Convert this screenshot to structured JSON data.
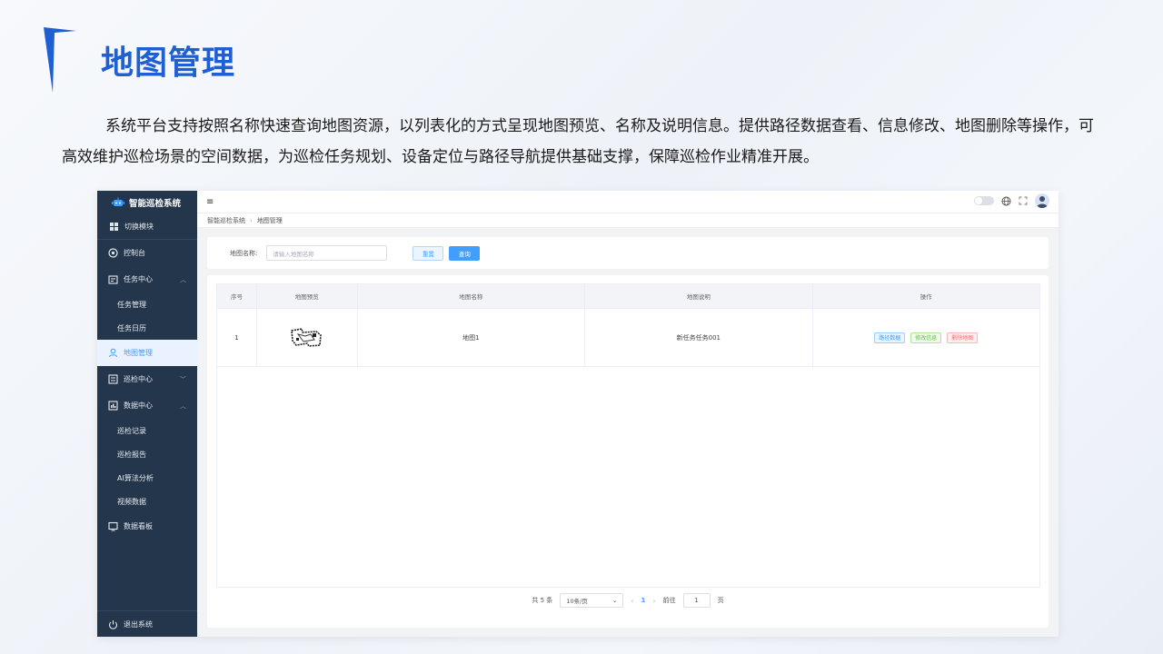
{
  "slide": {
    "title": "地图管理",
    "description": "系统平台支持按照名称快速查询地图资源，以列表化的方式呈现地图预览、名称及说明信息。提供路径数据查看、信息修改、地图删除等操作，可高效维护巡检场景的空间数据，为巡检任务规划、设备定位与路径导航提供基础支撑，保障巡检作业精准开展。",
    "accent_color": "#1e5fd4"
  },
  "app": {
    "brand": "智能巡检系统",
    "sidebar": {
      "switch_module": "切换模块",
      "items": [
        {
          "label": "控制台",
          "icon": "dashboard-icon"
        },
        {
          "label": "任务中心",
          "icon": "task-icon",
          "expanded": true
        },
        {
          "label": "任务管理",
          "sub": true
        },
        {
          "label": "任务日历",
          "sub": true
        },
        {
          "label": "地图管理",
          "icon": "map-icon",
          "active": true
        },
        {
          "label": "巡检中心",
          "icon": "inspect-icon",
          "expanded": false
        },
        {
          "label": "数据中心",
          "icon": "data-icon",
          "expanded": true
        },
        {
          "label": "巡检记录",
          "sub": true
        },
        {
          "label": "巡检报告",
          "sub": true
        },
        {
          "label": "AI算法分析",
          "sub": true
        },
        {
          "label": "视频数据",
          "sub": true
        },
        {
          "label": "数据看板",
          "icon": "board-icon"
        }
      ],
      "logout": "退出系统"
    },
    "topbar": {
      "menu_icon": "≡"
    },
    "breadcrumb": [
      "智能巡检系统",
      "地图管理"
    ],
    "search": {
      "label": "地图名称:",
      "placeholder": "请输入地图名称",
      "reset": "重置",
      "query": "查询"
    },
    "table": {
      "headers": [
        "序号",
        "地图预览",
        "地图名称",
        "地图说明",
        "操作"
      ],
      "rows": [
        {
          "index": "1",
          "name": "地图1",
          "desc": "新任务任务001"
        }
      ],
      "actions": {
        "view": "路径数据",
        "edit": "修改信息",
        "delete": "删除地图"
      }
    },
    "pagination": {
      "total": "共 5 条",
      "page_size": "10条/页",
      "current": "1",
      "goto_label": "前往",
      "goto_value": "1",
      "page_unit": "页"
    }
  }
}
